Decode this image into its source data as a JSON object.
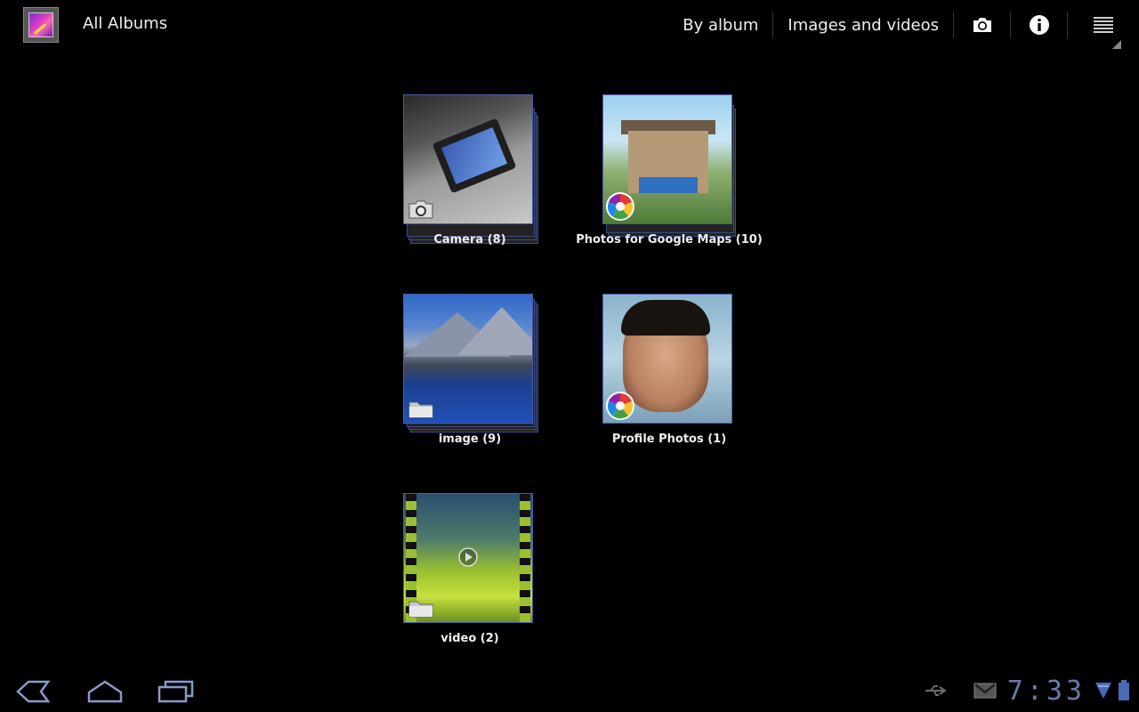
{
  "actionbar": {
    "title": "All Albums",
    "view_mode_label": "By album",
    "filter_label": "Images and videos",
    "camera_icon": "camera-icon",
    "info_icon": "info-icon",
    "menu_icon": "menu-icon"
  },
  "albums": [
    {
      "label": "Camera (8)",
      "badge": "camera-icon"
    },
    {
      "label": "Photos for Google Maps (10)",
      "badge": "picasa-icon"
    },
    {
      "label": "image (9)",
      "badge": "folder-icon"
    },
    {
      "label": "Profile Photos (1)",
      "badge": "picasa-icon"
    },
    {
      "label": "video (2)",
      "badge": "folder-icon"
    }
  ],
  "statusbar": {
    "time": "7:33",
    "icons": [
      "usb-icon",
      "gmail-icon",
      "wifi-icon",
      "battery-icon"
    ]
  },
  "colors": {
    "background": "#000000",
    "thumb_border": "#4a5aa8",
    "clock": "#6a7aa8"
  }
}
